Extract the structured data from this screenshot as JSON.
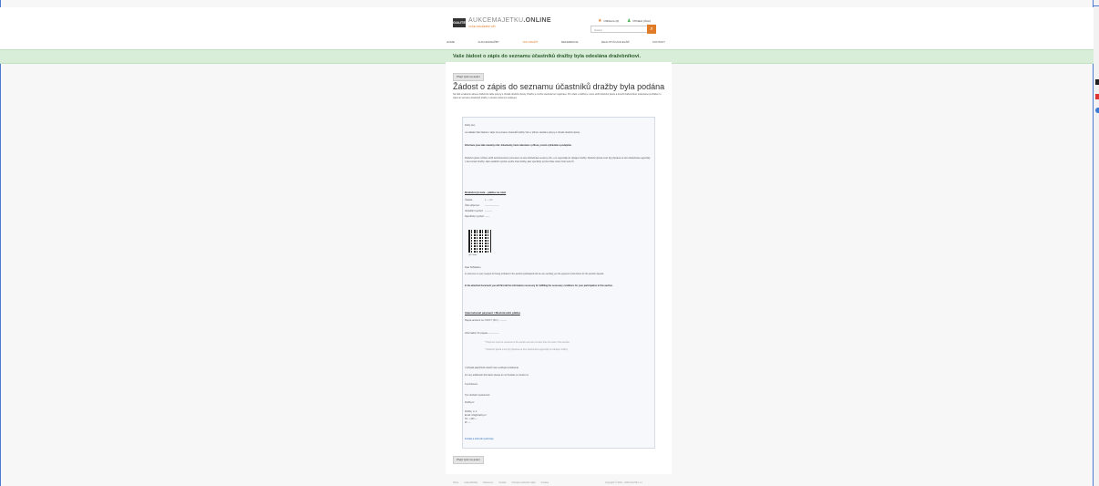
{
  "header": {
    "logo_box": "GAUTE",
    "logo_title": "AUKCEMAJETKU",
    "logo_suffix": ".ONLINE",
    "logo_sub": "VAŠE DRAŽEBNÍ SÍŇ",
    "favorites": "Oblíbené (0)",
    "login": "Přihlásit (Účet)",
    "search_placeholder": "Hledat"
  },
  "nav": [
    "HOME",
    "AUKCE/DRAŽBY",
    "JAK DRAŽIT",
    "REFERENCE",
    "REALITNÍ KANCELÁŘ",
    "KONTAKT"
  ],
  "banner": "Vaše žádost o zápis do seznamu účastníků dražby byla odeslána dražebníkovi.",
  "page": {
    "print_button": "Přejít zpět na aukci",
    "title": "Žádost o zápis do seznamu účastníků dražby byla podána",
    "intro": "Na Vaší emailovou adresu dražebník zašle pokyny k úhradě dražební jistoty. Dražbu je možné sledovat bez registrace. Pro účast v dražbě je nutné složit dražební jistotu a doručit dražebníkovi podepsané prohlášení o zápis do seznamu účastníků dražby s úředně ověřeným podpisem."
  },
  "email": {
    "greeting": "Dobrý den,",
    "p1": "na základě Vaší žádosti o zápis do seznamu účastníků dražby Vám v příloze zasíláme pokyny k úhradě dražební jistoty.",
    "p2_bold": "Informace jsou také uvedeny níže; dokumenty, které naleznete v příloze, prosím vytiskněte a podepište.",
    "p3": "Dražební jistotu můžete složit bezhotovostním převodem na účet dražebníka uvedený níže, a to nejpozději do zahájení dražby. Dražební jistota musí být připsána na účet dražebníka nejpozději v den konání dražby. Jako variabilní symbol uveďte číslo dražby, jako specifický symbol Vaše rodné číslo nebo IČ.",
    "h1": "Dražební jistota - platba na účet",
    "kv": [
      {
        "k": "Částka:",
        "v": "1 — Kč"
      },
      {
        "k": "Účet příjemce:",
        "v": "——————"
      },
      {
        "k": "Variabilní symbol:",
        "v": "———"
      },
      {
        "k": "Specifický symbol:",
        "v": "——"
      }
    ],
    "qr_caption": "QR Platba",
    "greeting_en": "Dear Sir/Madam,",
    "p4": "in reference to your request for being included in the auction participants list we are sending you the payment instructions for the auction deposit.",
    "p5_bold": "In the attached document you will find all the information necessary for fulfilling the necessary conditions for your participation in this auction.",
    "h2": "International payment / Mezinárodní platba",
    "iban_label": "Payee account no.:",
    "iban_value": "SWIFT (BIC): ———",
    "info_label": "Information for payee:",
    "info_value": "——————",
    "note1": "* Payment must be received on the auction account no later than the start of the auction.",
    "note2": "* Dražební jistota musí být připsána na účet dražebníka nejpozději do zahájení dražby.",
    "p6": "V případě jakýchkoliv dotazů nás neváhejte kontaktovat.",
    "p7": "For any additional information please do not hesitate to contact us.",
    "sign": "S pozdravem",
    "team": "Tým dražební společnosti",
    "web": "Dražby.cz",
    "contact1": "Dražby, s.r.o.",
    "contact2": "Email: info@drazby.cz",
    "contact3": "Tel.: +420 —",
    "contact4": "ID: —",
    "link": "Kontakt a obchodní podmínky"
  },
  "bottom_button": "Přejít zpět na aukci",
  "footer": {
    "links": [
      "Home",
      "Aukce/Dražby",
      "Reference",
      "Kontakt",
      "Ochrana osobních údajů",
      "Cookies"
    ],
    "copyright": "Copyright © 2024 – 2026 GAUTE s.r.o."
  },
  "colors": {
    "accent": "#e07b27",
    "banner_bg": "#d9eed9",
    "frame": "#4a7bd0"
  }
}
